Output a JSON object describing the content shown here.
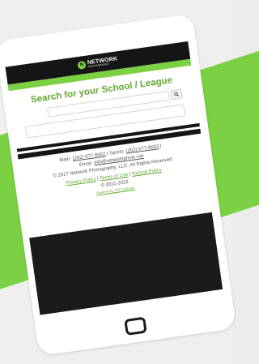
{
  "brand": {
    "logo_mark": "N",
    "logo_main": "NETWORK",
    "logo_sub": "PHOTOGRAPHY"
  },
  "search": {
    "title": "Search for your School / League",
    "input_value": "",
    "button_icon": "search-icon"
  },
  "footer": {
    "main_label": "Main:",
    "main_phone": "(262) 677-8662",
    "sports_label": "Sports:",
    "sports_phone": "(262) 677-8663",
    "email_label": "Email:",
    "email": "info@networkphoto.net",
    "copyright": "© 2017 Network Photography, LLC. All Rights Reserved",
    "privacy": "Privacy Policy",
    "terms": "Terms of Use",
    "refund": "Refund Policy",
    "years": "© 2011-2022",
    "powered": "Powered By TPO Software"
  },
  "colors": {
    "accent": "#7bd043",
    "accent_text": "#64a832",
    "dark": "#151515"
  }
}
